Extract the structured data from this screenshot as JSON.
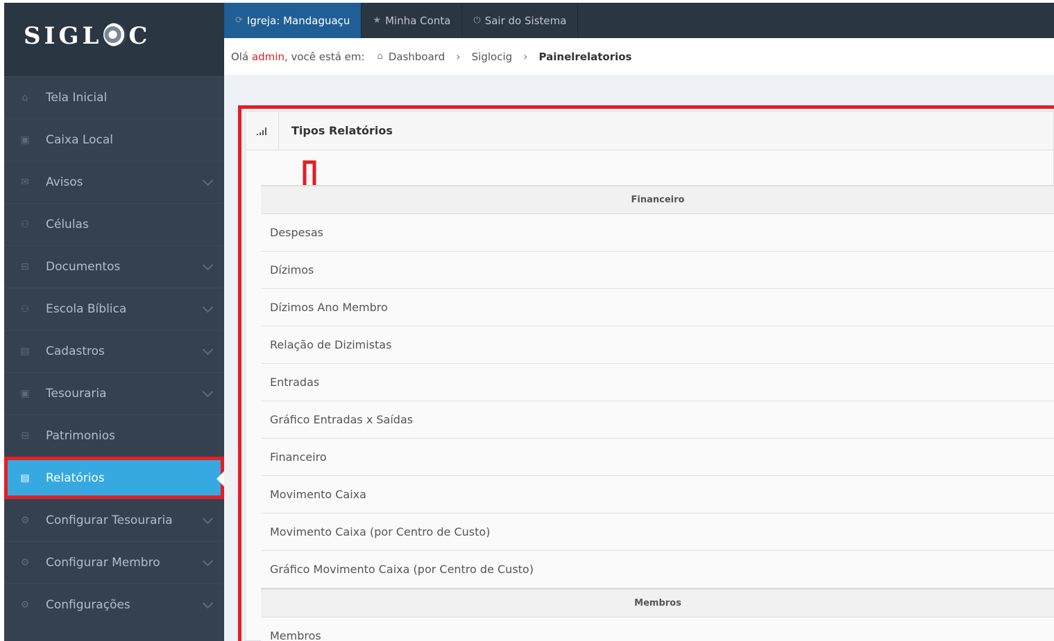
{
  "brand": {
    "logo_text_left": "SIGL",
    "logo_text_right": "C"
  },
  "sidebar": {
    "items": [
      {
        "label": "Tela Inicial",
        "icon": "home-icon",
        "icon_glyph": "⌂",
        "expandable": false,
        "active": false
      },
      {
        "label": "Caixa Local",
        "icon": "money-icon",
        "icon_glyph": "▣",
        "expandable": false,
        "active": false
      },
      {
        "label": "Avisos",
        "icon": "envelope-icon",
        "icon_glyph": "✉",
        "expandable": true,
        "active": false
      },
      {
        "label": "Células",
        "icon": "group-icon",
        "icon_glyph": "⚇",
        "expandable": false,
        "active": false
      },
      {
        "label": "Documentos",
        "icon": "drive-icon",
        "icon_glyph": "⊟",
        "expandable": true,
        "active": false
      },
      {
        "label": "Escola Bíblica",
        "icon": "group-icon",
        "icon_glyph": "⚇",
        "expandable": true,
        "active": false
      },
      {
        "label": "Cadastros",
        "icon": "list-icon",
        "icon_glyph": "▤",
        "expandable": true,
        "active": false
      },
      {
        "label": "Tesouraria",
        "icon": "money-icon",
        "icon_glyph": "▣",
        "expandable": true,
        "active": false
      },
      {
        "label": "Patrimonios",
        "icon": "drive-icon",
        "icon_glyph": "⊟",
        "expandable": false,
        "active": false
      },
      {
        "label": "Relatórios",
        "icon": "list-icon",
        "icon_glyph": "▤",
        "expandable": false,
        "active": true
      },
      {
        "label": "Configurar Tesouraria",
        "icon": "gear-icon",
        "icon_glyph": "⚙",
        "expandable": true,
        "active": false
      },
      {
        "label": "Configurar Membro",
        "icon": "gear-icon",
        "icon_glyph": "⚙",
        "expandable": true,
        "active": false
      },
      {
        "label": "Configurações",
        "icon": "gear-icon",
        "icon_glyph": "⚙",
        "expandable": true,
        "active": false
      }
    ]
  },
  "topbar": {
    "church_label": "Igreja: Mandaguaçu",
    "account_label": "Minha Conta",
    "logout_label": "Sair do Sistema"
  },
  "breadcrumb": {
    "greeting": "Olá",
    "user": "admin",
    "suffix": ", você está em:",
    "items": [
      "Dashboard",
      "Siglocig",
      "Painelrelatorios"
    ]
  },
  "portlet": {
    "title": "Tipos Relatórios",
    "groups": [
      {
        "heading": "Financeiro",
        "rows": [
          "Despesas",
          "Dízimos",
          "Dízimos Ano Membro",
          "Relação de Dizimistas",
          "Entradas",
          "Gráfico Entradas x Saídas",
          "Financeiro",
          "Movimento Caixa",
          "Movimento Caixa (por Centro de Custo)",
          "Gráfico Movimento Caixa (por Centro de Custo)"
        ]
      },
      {
        "heading": "Membros",
        "rows": [
          "Membros"
        ]
      }
    ]
  },
  "colors": {
    "sidebar_bg": "#364150",
    "active_item": "#36a9e1",
    "highlight_red": "#e31e24",
    "topbar_primary": "#1f5f95"
  }
}
